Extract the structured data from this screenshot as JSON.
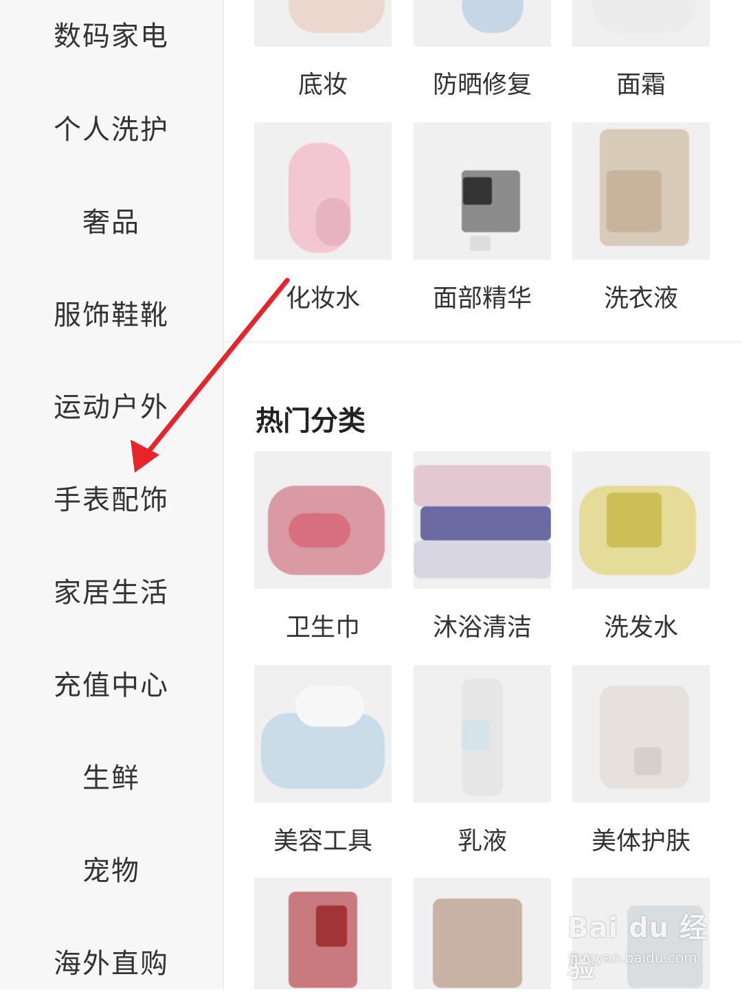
{
  "sidebar": {
    "items": [
      {
        "label": "数码家电"
      },
      {
        "label": "个人洗护"
      },
      {
        "label": "奢品"
      },
      {
        "label": "服饰鞋靴"
      },
      {
        "label": "运动户外"
      },
      {
        "label": "手表配饰"
      },
      {
        "label": "家居生活"
      },
      {
        "label": "充值中心"
      },
      {
        "label": "生鲜"
      },
      {
        "label": "宠物"
      },
      {
        "label": "海外直购"
      }
    ]
  },
  "top_grid": {
    "items": [
      {
        "label": "底妆"
      },
      {
        "label": "防晒修复"
      },
      {
        "label": "面霜"
      },
      {
        "label": "化妆水"
      },
      {
        "label": "面部精华"
      },
      {
        "label": "洗衣液"
      }
    ]
  },
  "hot_section": {
    "title": "热门分类",
    "items": [
      {
        "label": "卫生巾"
      },
      {
        "label": "沐浴清洁"
      },
      {
        "label": "洗发水"
      },
      {
        "label": "美容工具"
      },
      {
        "label": "乳液"
      },
      {
        "label": "美体护肤"
      }
    ]
  },
  "annotation": {
    "arrow_color": "#e8232a"
  },
  "watermark": {
    "logo": "Bai du 经验",
    "sub": "jingyan.baidu.com"
  }
}
